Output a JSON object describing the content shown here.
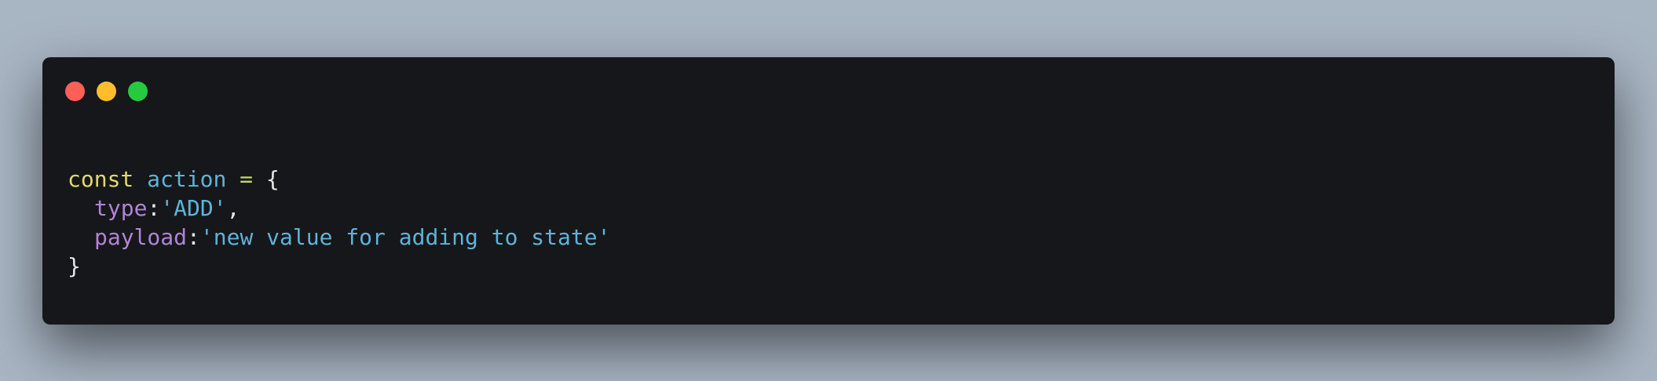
{
  "window": {
    "background": "#16171a",
    "buttons": [
      {
        "name": "close",
        "color": "#ff5f56"
      },
      {
        "name": "minimize",
        "color": "#ffbd2e"
      },
      {
        "name": "maximize",
        "color": "#27c93f"
      }
    ]
  },
  "code": {
    "colors": {
      "keyword": "#e0d96e",
      "identifier": "#5fb3d9",
      "operator": "#c2d86a",
      "punctuation": "#e6e6e6",
      "property": "#b184d6",
      "string": "#5fb3d9"
    },
    "line1": {
      "keyword": "const",
      "identifier": "action",
      "operator": "=",
      "brace": "{"
    },
    "line2": {
      "property": "type",
      "colon": ":",
      "value": "'ADD'",
      "comma": ","
    },
    "line3": {
      "property": "payload",
      "colon": ":",
      "value": "'new value for adding to state'"
    },
    "line4": {
      "brace": "}"
    }
  }
}
